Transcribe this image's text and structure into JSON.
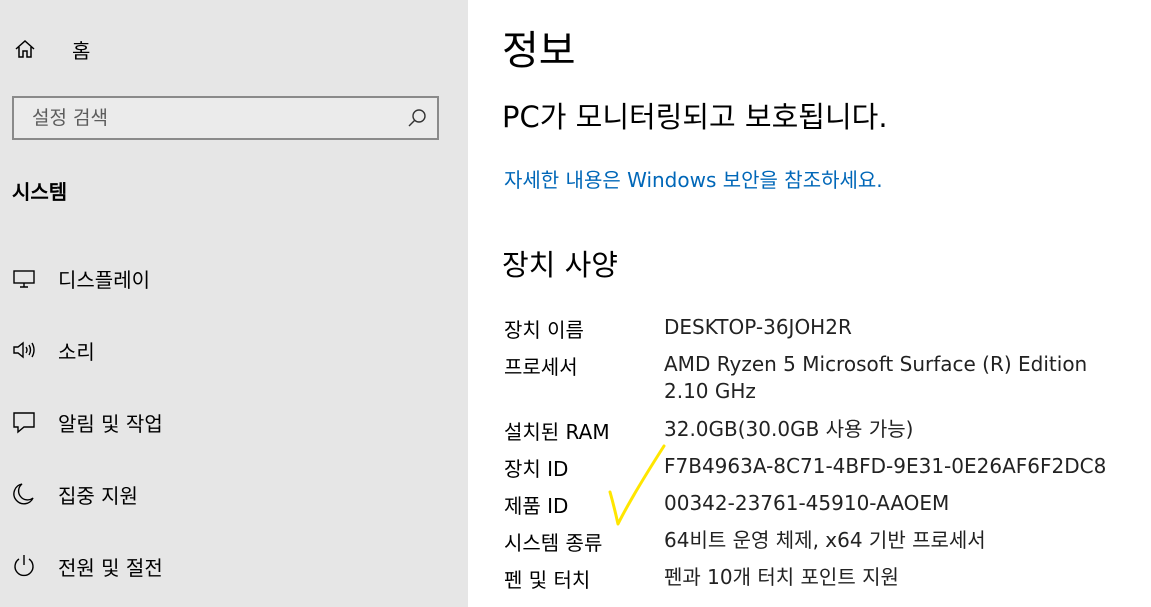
{
  "sidebar": {
    "home": {
      "label": "홈",
      "icon": "home-icon"
    },
    "search": {
      "placeholder": "설정 검색",
      "icon": "search-icon"
    },
    "section_title": "시스템",
    "items": [
      {
        "label": "디스플레이",
        "icon": "monitor-icon"
      },
      {
        "label": "소리",
        "icon": "speaker-icon"
      },
      {
        "label": "알림 및 작업",
        "icon": "message-icon"
      },
      {
        "label": "집중 지원",
        "icon": "moon-icon"
      },
      {
        "label": "전원 및 절전",
        "icon": "power-icon"
      }
    ]
  },
  "main": {
    "title": "정보",
    "status": "PC가 모니터링되고 보호됩니다.",
    "link": "자세한 내용은 Windows 보안을 참조하세요.",
    "specs_heading": "장치 사양",
    "specs": [
      {
        "label": "장치 이름",
        "value": "DESKTOP-36JOH2R"
      },
      {
        "label": "프로세서",
        "value": "AMD Ryzen 5 Microsoft Surface (R) Edition    2.10 GHz"
      },
      {
        "label": "설치된 RAM",
        "value": "32.0GB(30.0GB 사용 가능)"
      },
      {
        "label": "장치 ID",
        "value": "F7B4963A-8C71-4BFD-9E31-0E26AF6F2DC8"
      },
      {
        "label": "제품 ID",
        "value": "00342-23761-45910-AAOEM"
      },
      {
        "label": "시스템 종류",
        "value": "64비트 운영 체제, x64 기반 프로세서"
      },
      {
        "label": "펜 및 터치",
        "value": "펜과 10개 터치 포인트 지원"
      }
    ]
  },
  "colors": {
    "sidebar_bg": "#e6e6e6",
    "link": "#0067b8",
    "annotation": "#ffe600"
  }
}
